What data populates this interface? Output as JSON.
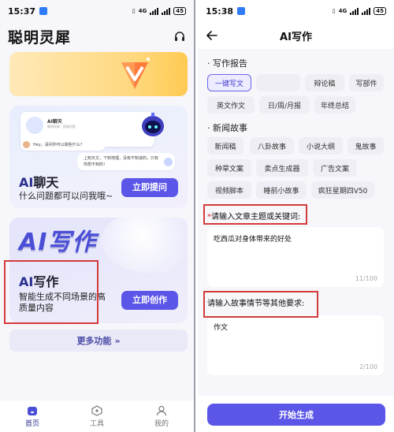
{
  "left_screen": {
    "status": {
      "time": "15:37",
      "net": "4G",
      "battery": "45"
    },
    "app_title": "聪明灵犀",
    "chat_card": {
      "mini_title": "AI聊天",
      "mini_sub": "聪明灵犀 · 智能问答",
      "question": "Hey，请问你可以做些什么？",
      "answer": "上知天文，下知地理，没有不知道的，只有你想不到的！",
      "title_ai": "AI",
      "title_rest": "聊天",
      "subtitle": "什么问题都可以问我哦~",
      "button": "立即提问"
    },
    "write_card": {
      "big_text": "AI写作",
      "title_ai": "AI",
      "title_rest": "写作",
      "subtitle_line1": "智能生成不同场景的高",
      "subtitle_line2": "质量内容",
      "button": "立即创作"
    },
    "more": {
      "label": "更多功能",
      "arrow": "»"
    },
    "nav": [
      {
        "label": "首页",
        "icon": "home-icon",
        "active": true
      },
      {
        "label": "工具",
        "icon": "tool-icon",
        "active": false
      },
      {
        "label": "我的",
        "icon": "profile-icon",
        "active": false
      }
    ]
  },
  "right_screen": {
    "status": {
      "time": "15:38",
      "net": "4G",
      "battery": "45"
    },
    "title": "AI写作",
    "section1": {
      "title": "· 写作报告",
      "chips": [
        "一键写文",
        "",
        "辩论稿",
        "写部件",
        "英文作文",
        "日/周/月报",
        "年终总结"
      ],
      "selected": "一键写文"
    },
    "section2": {
      "title": "· 新闻故事",
      "chips": [
        "新闻稿",
        "八卦故事",
        "小说大纲",
        "鬼故事",
        "种草文案",
        "卖点生成器",
        "广告文案",
        "视频脚本",
        "睡前小故事",
        "疯狂星期四V50"
      ]
    },
    "field1": {
      "required_mark": "*",
      "label": "请输入文章主题或关键词:",
      "value": "吃西瓜对身体带来的好处",
      "count": "11/100"
    },
    "field2": {
      "label": "请输入故事情节等其他要求:",
      "value": "作文",
      "count": "2/100"
    },
    "submit": "开始生成"
  },
  "colors": {
    "accent": "#5b56e8",
    "highlight_box": "#d33b3b",
    "banner": "#ffd87e"
  }
}
